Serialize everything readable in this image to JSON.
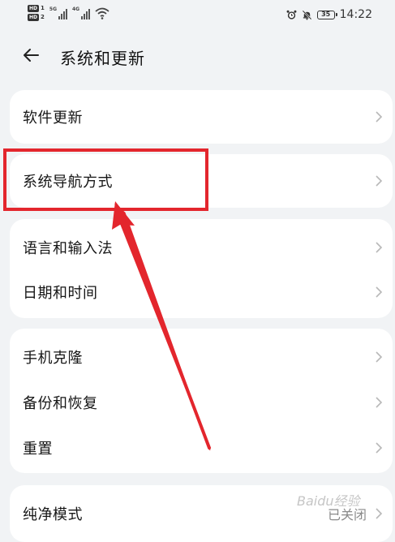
{
  "statusbar": {
    "sim1_badge": "HD",
    "sim1_num": "1",
    "sim2_badge": "HD",
    "sim2_num": "2",
    "net1": "5G",
    "net2": "4G",
    "battery": "35",
    "time": "14:22"
  },
  "header": {
    "title": "系统和更新"
  },
  "sections": [
    {
      "items": [
        {
          "label": "软件更新"
        }
      ]
    },
    {
      "items": [
        {
          "label": "系统导航方式"
        }
      ]
    },
    {
      "items": [
        {
          "label": "语言和输入法"
        },
        {
          "label": "日期和时间"
        }
      ]
    },
    {
      "items": [
        {
          "label": "手机克隆"
        },
        {
          "label": "备份和恢复"
        },
        {
          "label": "重置"
        }
      ]
    },
    {
      "items": [
        {
          "label": "纯净模式",
          "value": "已关闭"
        }
      ]
    }
  ],
  "annotation": {
    "color": "#e3262d"
  },
  "watermark": "Baidu经验"
}
